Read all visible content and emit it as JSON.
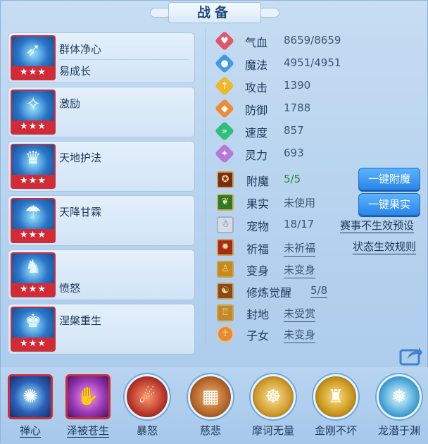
{
  "title": "战备",
  "skills": [
    {
      "name1": "群体净心",
      "name2": "易成长",
      "stars": "★★★"
    },
    {
      "name1": "激励",
      "name2": "",
      "stars": "★★★"
    },
    {
      "name1": "天地护法",
      "name2": "",
      "stars": "★★★"
    },
    {
      "name1": "天降甘霖",
      "name2": "",
      "stars": "★★★"
    },
    {
      "name1": "",
      "name2": "愤怒",
      "stars": "★★★"
    },
    {
      "name1": "涅槃重生",
      "name2": "",
      "stars": "★★★"
    }
  ],
  "stats": [
    {
      "label": "气血",
      "value": "8659/8659",
      "color": "#e0566a",
      "glyph": "♥"
    },
    {
      "label": "魔法",
      "value": "4951/4951",
      "color": "#3f9be6",
      "glyph": "●"
    },
    {
      "label": "攻击",
      "value": "1390",
      "color": "#f0b72c",
      "glyph": "↑"
    },
    {
      "label": "防御",
      "value": "1788",
      "color": "#f08a35",
      "glyph": "◆"
    },
    {
      "label": "速度",
      "value": "857",
      "color": "#2fbf79",
      "glyph": "»"
    },
    {
      "label": "灵力",
      "value": "693",
      "color": "#b778d9",
      "glyph": "✦"
    }
  ],
  "status": {
    "fumo": {
      "label": "附魔",
      "value": "5/5"
    },
    "guoshi": {
      "label": "果实",
      "value": "未使用"
    },
    "chongwu": {
      "label": "宠物",
      "value": "18/17"
    },
    "qifu": {
      "label": "祈福",
      "value": "未祈福"
    },
    "bianshen": {
      "label": "变身",
      "value": "未变身"
    },
    "xiulian": {
      "label": "修炼觉醒",
      "value": "5/8"
    },
    "fengdi": {
      "label": "封地",
      "value": "未受赏"
    },
    "zinv": {
      "label": "子女",
      "value": "未变身"
    }
  },
  "buttons": {
    "fumo": "一键附魔",
    "guoshi": "一键果实"
  },
  "links": {
    "saishi": "赛事不生效预设",
    "zhuangtai": "状态生效规则"
  },
  "bottom": [
    {
      "label": "禅心",
      "glyph": "✺",
      "bg": "#2b5fb8"
    },
    {
      "label": "泽被苍生",
      "glyph": "✋",
      "bg": "#9b3bb5"
    },
    {
      "label": "暴怒",
      "glyph": "☄",
      "bg": "#b7362c"
    },
    {
      "label": "慈悲",
      "glyph": "▦",
      "bg": "#b3652b"
    },
    {
      "label": "摩诃无量",
      "glyph": "☸",
      "bg": "#d09a2c"
    },
    {
      "label": "金刚不坏",
      "glyph": "♜",
      "bg": "#c8951e"
    },
    {
      "label": "龙潜于渊",
      "glyph": "❅",
      "bg": "#4aa6d8"
    }
  ]
}
